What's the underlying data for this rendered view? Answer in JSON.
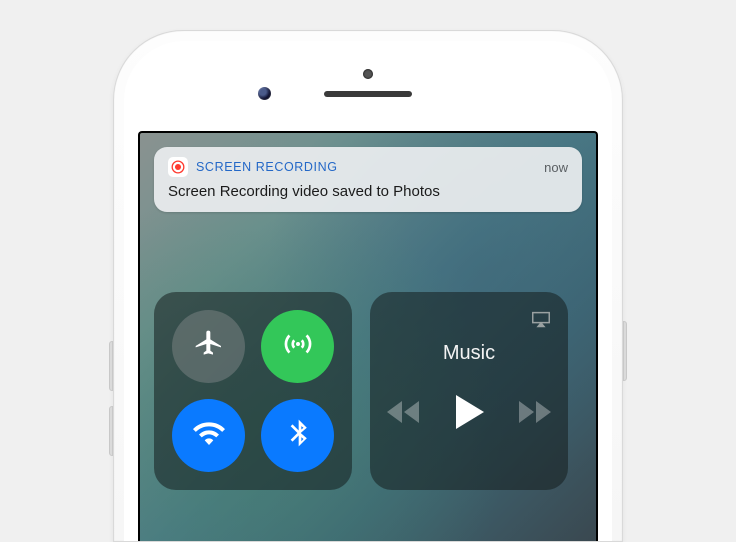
{
  "notification": {
    "app_name": "SCREEN RECORDING",
    "timestamp": "now",
    "message": "Screen Recording video saved to Photos",
    "app_color": "#2468c7"
  },
  "connectivity": {
    "airplane": {
      "name": "airplane-mode",
      "active": false
    },
    "cellular": {
      "name": "cellular-data",
      "active": true,
      "color": "#33c759"
    },
    "wifi": {
      "name": "wifi",
      "active": true,
      "color": "#0a7aff"
    },
    "bluetooth": {
      "name": "bluetooth",
      "active": true,
      "color": "#0a7aff"
    }
  },
  "media": {
    "label": "Music",
    "airplay_enabled": false,
    "playing": false
  }
}
